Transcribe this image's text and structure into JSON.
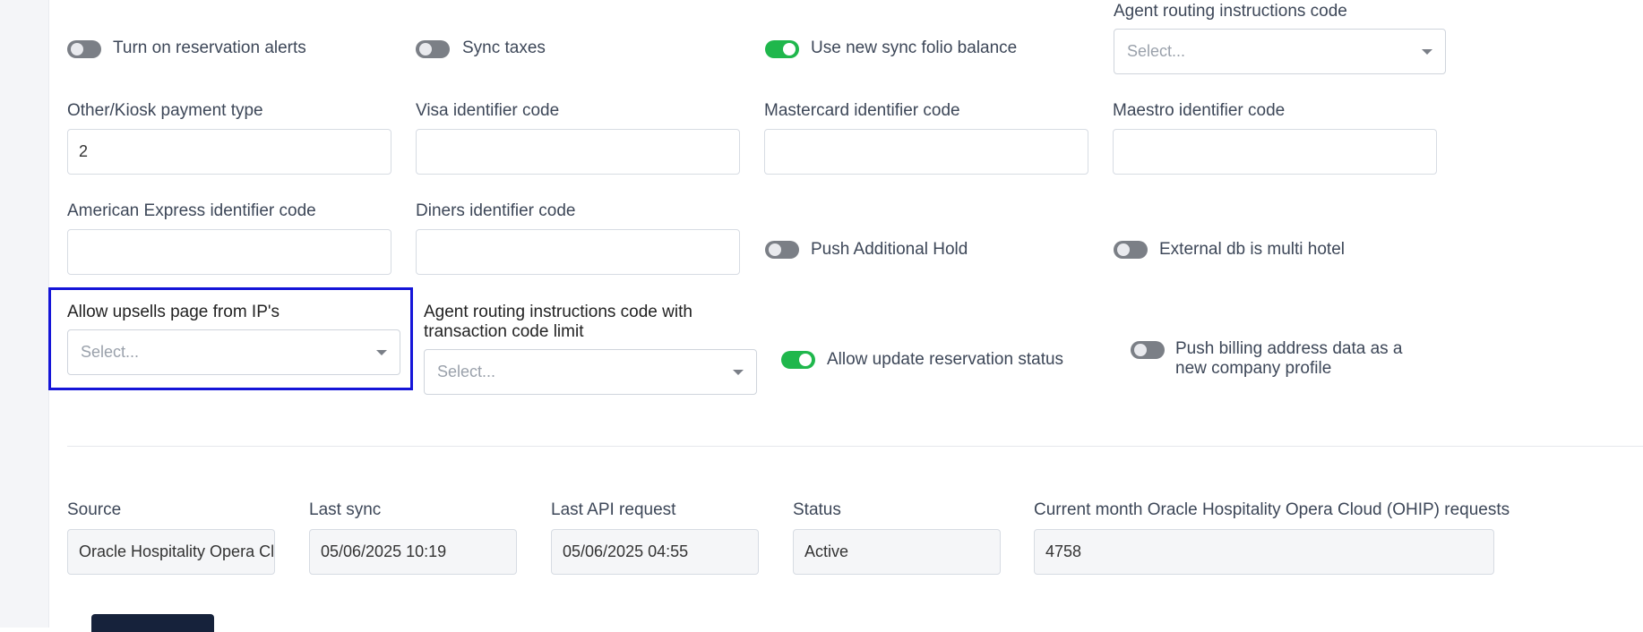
{
  "toggles": {
    "reservation_alerts": {
      "label": "Turn on reservation alerts",
      "on": false
    },
    "sync_taxes": {
      "label": "Sync taxes",
      "on": false
    },
    "sync_folio_balance": {
      "label": "Use new sync folio balance",
      "on": true
    },
    "push_additional_hold": {
      "label": "Push Additional Hold",
      "on": false
    },
    "external_db_multi_hotel": {
      "label": "External db is multi hotel",
      "on": false
    },
    "allow_update_reservation_status": {
      "label": "Allow update reservation status",
      "on": true
    },
    "push_billing_address": {
      "label": "Push billing address data as a new company profile",
      "on": false
    }
  },
  "fields": {
    "agent_routing_code": {
      "label": "Agent routing instructions code",
      "placeholder": "Select..."
    },
    "other_kiosk_payment_type": {
      "label": "Other/Kiosk payment type",
      "value": "2"
    },
    "visa_identifier_code": {
      "label": "Visa identifier code",
      "value": ""
    },
    "mastercard_identifier_code": {
      "label": "Mastercard identifier code",
      "value": ""
    },
    "maestro_identifier_code": {
      "label": "Maestro identifier code",
      "value": ""
    },
    "amex_identifier_code": {
      "label": "American Express identifier code",
      "value": ""
    },
    "diners_identifier_code": {
      "label": "Diners identifier code",
      "value": ""
    },
    "allow_upsells_ips": {
      "label": "Allow upsells page from IP's",
      "placeholder": "Select..."
    },
    "agent_routing_code_limit": {
      "label": "Agent routing instructions code with transaction code limit",
      "placeholder": "Select..."
    }
  },
  "info": {
    "source": {
      "label": "Source",
      "value": "Oracle Hospitality Opera Cloud"
    },
    "last_sync": {
      "label": "Last sync",
      "value": "05/06/2025 10:19"
    },
    "last_api_request": {
      "label": "Last API request",
      "value": "05/06/2025 04:55"
    },
    "status": {
      "label": "Status",
      "value": "Active"
    },
    "ohip_requests": {
      "label": "Current month Oracle Hospitality Opera Cloud (OHIP) requests",
      "value": "4758"
    }
  }
}
